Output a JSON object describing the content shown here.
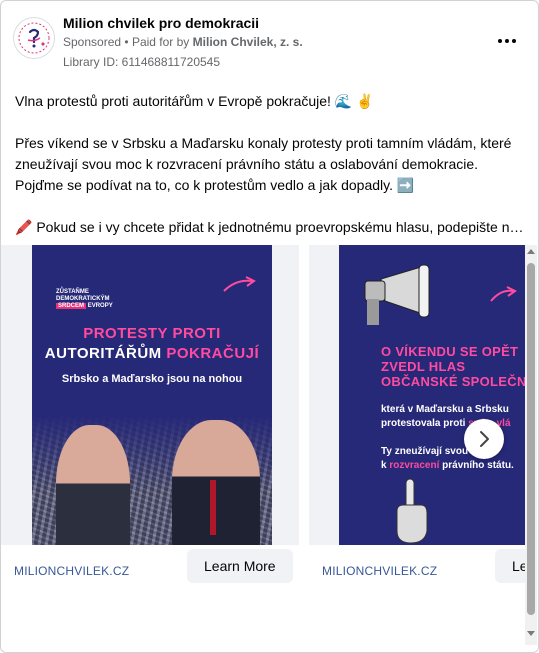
{
  "header": {
    "page_name": "Milion chvilek pro demokracii",
    "sponsored": "Sponsored",
    "paid_for_prefix": "Paid for by",
    "paid_for_name": "Milion Chvilek, z. s.",
    "library_id": "Library ID: 611468811720545"
  },
  "post": {
    "line1": "Vlna protestů proti autoritářům v Evropě pokračuje! 🌊 ✌️",
    "paragraph2": "Přes víkend se v Srbsku a Maďarsku konaly protesty proti tamním vládám, které zneužívají svou moc k rozvracení právního státu a oslabování demokracie. Pojďme se podívat na to, co k protestům vedlo a jak dopadly. ➡️",
    "line3": "🖍️ Pokud se i vy chcete přidat k jednotnému proevropskému hlasu, podepište na…"
  },
  "cards": [
    {
      "poster_small_1": "ZŮSTAŇME",
      "poster_small_2": "DEMOKRATICKÝM",
      "poster_small_3": "SRDCEM",
      "poster_small_4": "EVROPY",
      "title_line1": "PROTESTY PROTI",
      "title_line2_white": "AUTORITÁŘŮM ",
      "title_line2_pink": "POKRAČUJÍ",
      "subtitle": "Srbsko a Maďarsko jsou na nohou",
      "link": "MILIONCHVILEK.CZ",
      "cta": "Learn More"
    },
    {
      "title_line1": "O VÍKENDU SE OPĚT",
      "title_line2": "ZVEDL HLAS",
      "title_line3": "OBČANSKÉ SPOLEČNOS",
      "text_line1": "která v Maďarsku a Srbsku",
      "text_line2_white": "protestovala proti ",
      "text_line2_pink": "svým vlá",
      "text_line3": "Ty zneužívají svou",
      "text_line4_white": "k ",
      "text_line4_pink": "rozvracení",
      "text_line4_end": " právního státu.",
      "link": "MILIONCHVILEK.CZ",
      "cta": "Le"
    }
  ],
  "icons": {
    "more": "more-horizontal-icon",
    "next": "chevron-right-icon"
  },
  "colors": {
    "poster_bg": "#262878",
    "accent_pink": "#ff4ba0",
    "link": "#385898"
  }
}
